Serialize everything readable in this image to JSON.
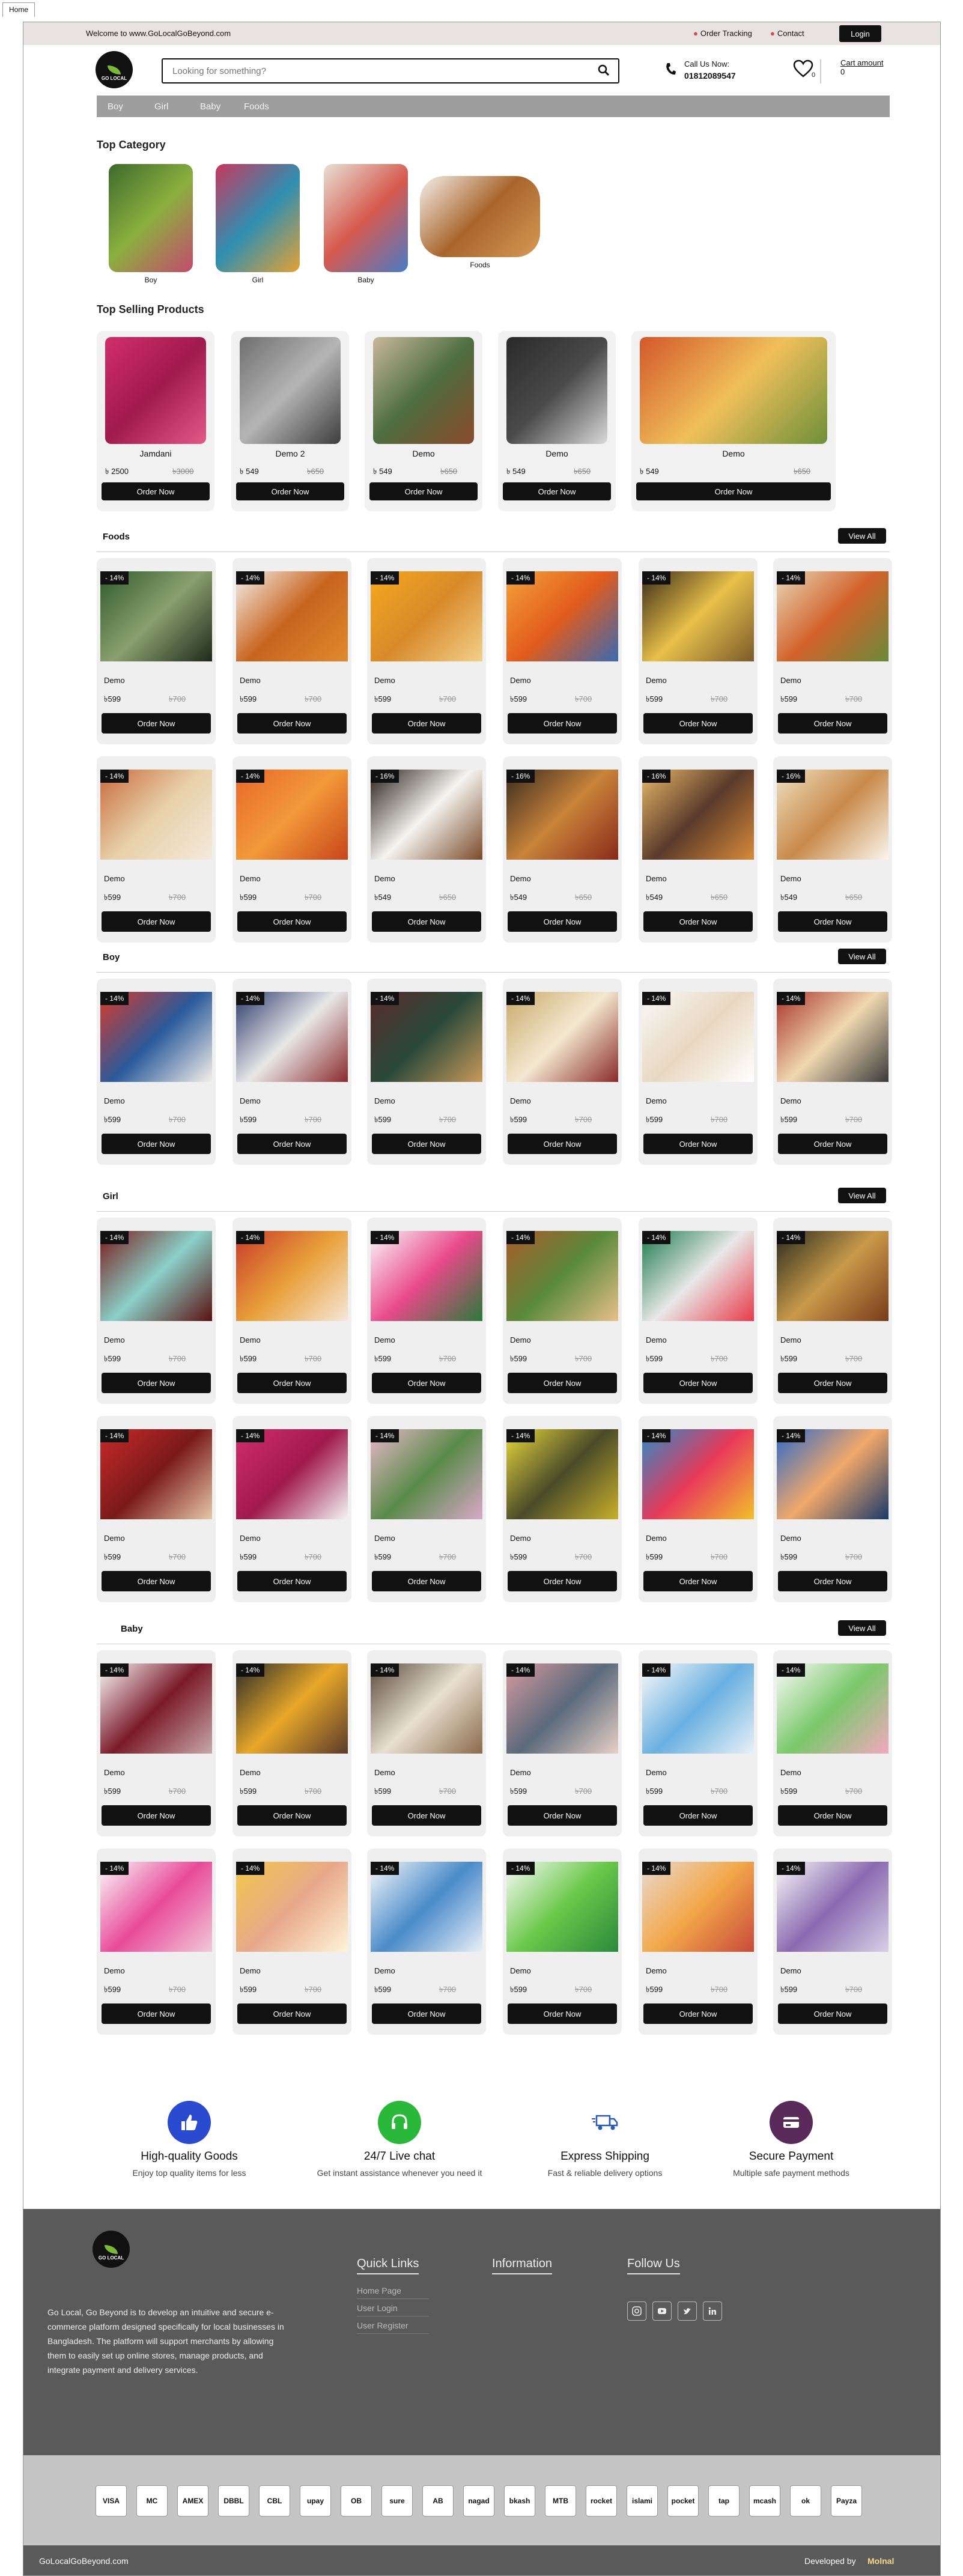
{
  "browser": {
    "tab": "Home"
  },
  "topbar": {
    "welcome": "Welcome to www.GoLocalGoBeyond.com",
    "order_tracking": "Order Tracking",
    "contact": "Contact",
    "login": "Login"
  },
  "header": {
    "logo_text": "GO LOCAL",
    "search_placeholder": "Looking for something?",
    "call_label": "Call Us Now:",
    "phone": "01812089547",
    "wishlist_count": "0",
    "cart_label": "Cart amount",
    "cart_value": "0"
  },
  "nav": [
    "Boy",
    "Girl",
    "Baby",
    "Foods"
  ],
  "top_category": {
    "title": "Top Category",
    "items": [
      {
        "label": "Boy",
        "colors": [
          "#3d6a2c",
          "#8ab03e",
          "#c44a6e"
        ]
      },
      {
        "label": "Girl",
        "colors": [
          "#c8385e",
          "#2e8fb0",
          "#e3a235"
        ]
      },
      {
        "label": "Baby",
        "colors": [
          "#e8e0d4",
          "#d65a4e",
          "#4a7bc8"
        ]
      },
      {
        "label": "Foods",
        "colors": [
          "#f4efe8",
          "#a8652c",
          "#d69a56"
        ]
      }
    ]
  },
  "top_selling": {
    "title": "Top Selling Products",
    "button": "Order Now",
    "items": [
      {
        "name": "Jamdani",
        "price": "৳ 2500",
        "old": "৳3000",
        "colors": [
          "#d22e6a",
          "#a01a4c",
          "#e35a88"
        ]
      },
      {
        "name": "Demo 2",
        "price": "৳ 549",
        "old": "৳650",
        "colors": [
          "#6f6f6f",
          "#b5b5b5",
          "#3d3d3d"
        ]
      },
      {
        "name": "Demo",
        "price": "৳ 549",
        "old": "৳650",
        "colors": [
          "#c8b89c",
          "#4d6e3e",
          "#8a4a2e"
        ]
      },
      {
        "name": "Demo",
        "price": "৳ 549",
        "old": "৳650",
        "colors": [
          "#2a2a2a",
          "#4a4a4a",
          "#d9d9d9"
        ]
      },
      {
        "name": "Demo",
        "price": "৳ 549",
        "old": "৳650",
        "colors": [
          "#d2582a",
          "#f0c05a",
          "#6e8f3a"
        ]
      }
    ]
  },
  "sections": [
    {
      "id": "foods",
      "title": "Foods",
      "view_all": "View All",
      "rows": [
        [
          {
            "disc": "- 14%",
            "name": "Demo",
            "price": "৳599",
            "old": "৳700",
            "colors": [
              "#2f5a2a",
              "#8aa06e",
              "#1e2a1a"
            ]
          },
          {
            "disc": "- 14%",
            "name": "Demo",
            "price": "৳599",
            "old": "৳700",
            "colors": [
              "#f4f0ea",
              "#c8641e",
              "#e08a2e"
            ]
          },
          {
            "disc": "- 14%",
            "name": "Demo",
            "price": "৳599",
            "old": "৳700",
            "colors": [
              "#f6a81e",
              "#d88a2a",
              "#f2d08a"
            ]
          },
          {
            "disc": "- 14%",
            "name": "Demo",
            "price": "৳599",
            "old": "৳700",
            "colors": [
              "#f2a23a",
              "#e25c1c",
              "#3a6ab0"
            ]
          },
          {
            "disc": "- 14%",
            "name": "Demo",
            "price": "৳599",
            "old": "৳700",
            "colors": [
              "#3a2a1a",
              "#e8c04a",
              "#7a5a2a"
            ]
          },
          {
            "disc": "- 14%",
            "name": "Demo",
            "price": "৳599",
            "old": "৳700",
            "colors": [
              "#e8d8b8",
              "#d2622a",
              "#6a8a3a"
            ]
          }
        ],
        [
          {
            "disc": "- 14%",
            "name": "Demo",
            "price": "৳599",
            "old": "৳700",
            "colors": [
              "#c86a3a",
              "#e8d0a8",
              "#f4eadc"
            ]
          },
          {
            "disc": "- 14%",
            "name": "Demo",
            "price": "৳599",
            "old": "৳700",
            "colors": [
              "#e8662a",
              "#f29a3a",
              "#c8441a"
            ]
          },
          {
            "disc": "- 16%",
            "name": "Demo",
            "price": "৳549",
            "old": "৳650",
            "colors": [
              "#2a1e1a",
              "#f4f4f0",
              "#7a4a2a"
            ]
          },
          {
            "disc": "- 16%",
            "name": "Demo",
            "price": "৳549",
            "old": "৳650",
            "colors": [
              "#3a2a1e",
              "#c8843a",
              "#8a2a1a"
            ]
          },
          {
            "disc": "- 16%",
            "name": "Demo",
            "price": "৳549",
            "old": "৳650",
            "colors": [
              "#e8b86a",
              "#5a3a2a",
              "#d88a3a"
            ]
          },
          {
            "disc": "- 16%",
            "name": "Demo",
            "price": "৳549",
            "old": "৳650",
            "colors": [
              "#f0e0c0",
              "#c88a4a",
              "#fbf6ec"
            ]
          }
        ]
      ]
    },
    {
      "id": "boy",
      "title": "Boy",
      "view_all": "View All",
      "rows": [
        [
          {
            "disc": "- 14%",
            "name": "Demo",
            "price": "৳599",
            "old": "৳700",
            "colors": [
              "#d83a2a",
              "#2a5a9a",
              "#f4f0ea"
            ]
          },
          {
            "disc": "- 14%",
            "name": "Demo",
            "price": "৳599",
            "old": "৳700",
            "colors": [
              "#2a3a6a",
              "#e8e8e8",
              "#8a2a2a"
            ]
          },
          {
            "disc": "- 14%",
            "name": "Demo",
            "price": "৳599",
            "old": "৳700",
            "colors": [
              "#5a2a2a",
              "#2a4a3a",
              "#c89a5a"
            ]
          },
          {
            "disc": "- 14%",
            "name": "Demo",
            "price": "৳599",
            "old": "৳700",
            "colors": [
              "#c8a86a",
              "#f4e8d0",
              "#8a2a2a"
            ]
          },
          {
            "disc": "- 14%",
            "name": "Demo",
            "price": "৳599",
            "old": "৳700",
            "colors": [
              "#f8f8f8",
              "#e8d8c0",
              "#ffffff"
            ]
          },
          {
            "disc": "- 14%",
            "name": "Demo",
            "price": "৳599",
            "old": "৳700",
            "colors": [
              "#a8322a",
              "#f0d8b0",
              "#3a3a3a"
            ]
          }
        ]
      ]
    },
    {
      "id": "girl",
      "title": "Girl",
      "view_all": "View All",
      "rows": [
        [
          {
            "disc": "- 14%",
            "name": "Demo",
            "price": "৳599",
            "old": "৳700",
            "colors": [
              "#7a1a1a",
              "#8ad0c8",
              "#5a1010"
            ]
          },
          {
            "disc": "- 14%",
            "name": "Demo",
            "price": "৳599",
            "old": "৳700",
            "colors": [
              "#c83a2a",
              "#e8a03a",
              "#f4e8d8"
            ]
          },
          {
            "disc": "- 14%",
            "name": "Demo",
            "price": "৳599",
            "old": "৳700",
            "colors": [
              "#fafafa",
              "#e84a8a",
              "#2a7a3a"
            ]
          },
          {
            "disc": "- 14%",
            "name": "Demo",
            "price": "৳599",
            "old": "৳700",
            "colors": [
              "#a85a2a",
              "#5a8a3a",
              "#e8c08a"
            ]
          },
          {
            "disc": "- 14%",
            "name": "Demo",
            "price": "৳599",
            "old": "৳700",
            "colors": [
              "#1a7a4a",
              "#e8e8e8",
              "#e83a4a"
            ]
          },
          {
            "disc": "- 14%",
            "name": "Demo",
            "price": "৳599",
            "old": "৳700",
            "colors": [
              "#2a2a1e",
              "#c89a4a",
              "#7a3a1a"
            ]
          }
        ],
        [
          {
            "disc": "- 14%",
            "name": "Demo",
            "price": "৳599",
            "old": "৳700",
            "colors": [
              "#c82a2a",
              "#7a1a1a",
              "#e8c8a8"
            ]
          },
          {
            "disc": "- 14%",
            "name": "Demo",
            "price": "৳599",
            "old": "৳700",
            "colors": [
              "#d22e6a",
              "#a01a4c",
              "#f4f4f4"
            ]
          },
          {
            "disc": "- 14%",
            "name": "Demo",
            "price": "৳599",
            "old": "৳700",
            "colors": [
              "#e8b8c8",
              "#5a8a4a",
              "#d8a8c8"
            ]
          },
          {
            "disc": "- 14%",
            "name": "Demo",
            "price": "৳599",
            "old": "৳700",
            "colors": [
              "#e8d83a",
              "#4a4a2a",
              "#c8b02a"
            ]
          },
          {
            "disc": "- 14%",
            "name": "Demo",
            "price": "৳599",
            "old": "৳700",
            "colors": [
              "#2a8ac8",
              "#e83a5a",
              "#f2c02a"
            ]
          },
          {
            "disc": "- 14%",
            "name": "Demo",
            "price": "৳599",
            "old": "৳700",
            "colors": [
              "#2a6ac8",
              "#f2a86a",
              "#1a3a6a"
            ]
          }
        ]
      ]
    },
    {
      "id": "baby",
      "title": "Baby",
      "view_all": "View All",
      "rows": [
        [
          {
            "disc": "- 14%",
            "name": "Demo",
            "price": "৳599",
            "old": "৳700",
            "colors": [
              "#fafafa",
              "#7a1a2a",
              "#c8a8a8"
            ]
          },
          {
            "disc": "- 14%",
            "name": "Demo",
            "price": "৳599",
            "old": "৳700",
            "colors": [
              "#2a2a2a",
              "#e8a82a",
              "#5a3a2a"
            ]
          },
          {
            "disc": "- 14%",
            "name": "Demo",
            "price": "৳599",
            "old": "৳700",
            "colors": [
              "#5a4a3a",
              "#e8e0d0",
              "#8a6a4a"
            ]
          },
          {
            "disc": "- 14%",
            "name": "Demo",
            "price": "৳599",
            "old": "৳700",
            "colors": [
              "#d89aa0",
              "#5a6a7a",
              "#e8d0c8"
            ]
          },
          {
            "disc": "- 14%",
            "name": "Demo",
            "price": "৳599",
            "old": "৳700",
            "colors": [
              "#fafafa",
              "#6ab0e0",
              "#e8f0f8"
            ]
          },
          {
            "disc": "- 14%",
            "name": "Demo",
            "price": "৳599",
            "old": "৳700",
            "colors": [
              "#fafafa",
              "#7ac86a",
              "#f2a8c0"
            ]
          }
        ],
        [
          {
            "disc": "- 14%",
            "name": "Demo",
            "price": "৳599",
            "old": "৳700",
            "colors": [
              "#fafafa",
              "#e84a9a",
              "#f2c8d8"
            ]
          },
          {
            "disc": "- 14%",
            "name": "Demo",
            "price": "৳599",
            "old": "৳700",
            "colors": [
              "#f2c84a",
              "#e8a88a",
              "#fff4d8"
            ]
          },
          {
            "disc": "- 14%",
            "name": "Demo",
            "price": "৳599",
            "old": "৳700",
            "colors": [
              "#fafafa",
              "#4a8ac8",
              "#e8f0f8"
            ]
          },
          {
            "disc": "- 14%",
            "name": "Demo",
            "price": "৳599",
            "old": "৳700",
            "colors": [
              "#fafafa",
              "#6ac84a",
              "#2a8a3a"
            ]
          },
          {
            "disc": "- 14%",
            "name": "Demo",
            "price": "৳599",
            "old": "৳700",
            "colors": [
              "#e8d8d0",
              "#f2a84a",
              "#c84a3a"
            ]
          },
          {
            "disc": "- 14%",
            "name": "Demo",
            "price": "৳599",
            "old": "৳700",
            "colors": [
              "#fafafa",
              "#8a6ab0",
              "#d8d0e8"
            ]
          }
        ]
      ]
    }
  ],
  "features": [
    {
      "title": "High-quality Goods",
      "desc": "Enjoy top quality items for less",
      "color": "#2a4ad0",
      "icon": "thumbs-up-icon"
    },
    {
      "title": "24/7 Live chat",
      "desc": "Get instant assistance whenever you need it",
      "color": "#2ab83a",
      "icon": "headset-icon"
    },
    {
      "title": "Express Shipping",
      "desc": "Fast & reliable delivery options",
      "color": "#2a5ab0",
      "icon": "truck-icon"
    },
    {
      "title": "Secure Payment",
      "desc": "Multiple safe payment methods",
      "color": "#5a2a5a",
      "icon": "card-icon"
    }
  ],
  "footer": {
    "about": "Go Local, Go Beyond is to develop an intuitive and secure e-commerce platform designed specifically for local businesses in Bangladesh. The platform will support merchants by allowing them to easily set up online stores, manage products, and integrate payment and delivery services.",
    "quick_links_title": "Quick Links",
    "quick_links": [
      "Home Page",
      "User Login",
      "User Register"
    ],
    "information_title": "Information",
    "follow_title": "Follow Us",
    "copyright": "GoLocalGoBeyond.com",
    "developed_by": "Developed by",
    "developer": "Molnal"
  },
  "payments": [
    "VISA",
    "MC",
    "AMEX",
    "DBBL",
    "CBL",
    "upay",
    "OB",
    "sure",
    "AB",
    "nagad",
    "bkash",
    "MTB",
    "rocket",
    "islami",
    "pocket",
    "tap",
    "mcash",
    "ok",
    "Payza"
  ]
}
